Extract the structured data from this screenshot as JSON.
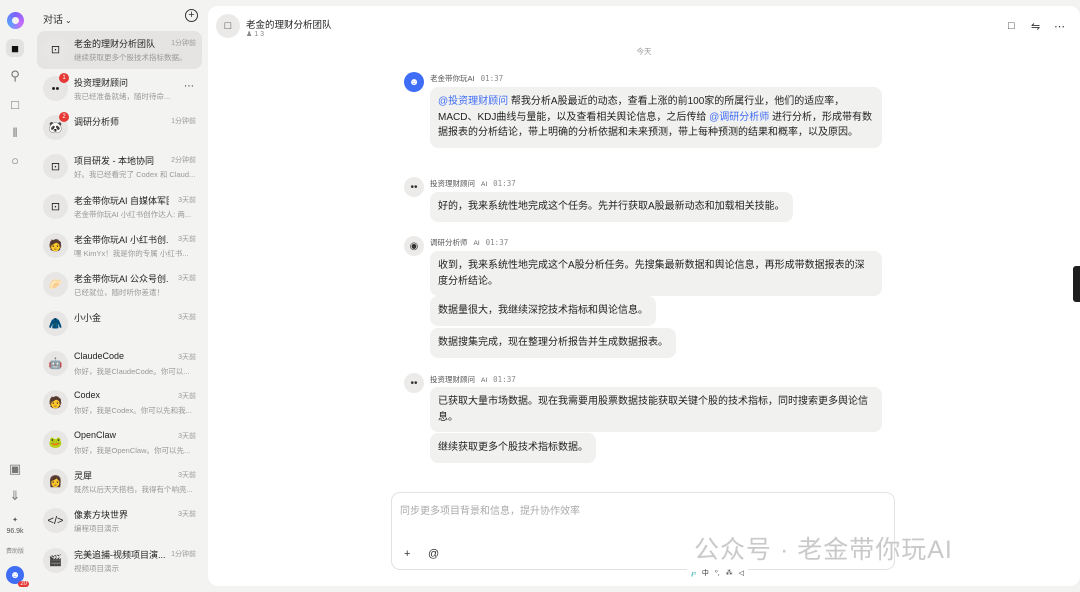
{
  "rail": {
    "points": "96.9k",
    "points_label": "费助版",
    "user_badge": "20"
  },
  "sidebar": {
    "header": "对话",
    "items": [
      {
        "title": "老金的理财分析团队",
        "time": "1分钟前",
        "preview": "继续获取更多个股技术指标数据。",
        "avatar": "⊡"
      },
      {
        "title": "投资理财顾问",
        "time": "",
        "preview": "我已经准备就绪，随时待命...",
        "avatar": "••",
        "badge": "1"
      },
      {
        "title": "调研分析师",
        "time": "1分钟前",
        "preview": "",
        "avatar": "🐼",
        "badge": "2"
      },
      {
        "title": "项目研发 - 本地协同",
        "time": "2分钟前",
        "preview": "好。我已经看完了 Codex 和 Claud...",
        "avatar": "⊡"
      },
      {
        "title": "老金带你玩AI 自媒体军团",
        "time": "3天前",
        "preview": "老金带你玩AI 小红书创作达人: 两...",
        "avatar": "⊡"
      },
      {
        "title": "老金带你玩AI 小红书创...",
        "time": "3天前",
        "preview": "嘿 KimYx！我是你的专属 小红书...",
        "avatar": "🧑"
      },
      {
        "title": "老金带你玩AI 公众号创...",
        "time": "3天前",
        "preview": "已经就位，随时听你差遣！",
        "avatar": "🥟"
      },
      {
        "title": "小小金",
        "time": "3天前",
        "preview": "",
        "avatar": "🧥"
      },
      {
        "title": "ClaudeCode",
        "time": "3天前",
        "preview": "你好，我是ClaudeCode。你可以...",
        "avatar": "🤖"
      },
      {
        "title": "Codex",
        "time": "3天前",
        "preview": "你好，我是Codex。你可以先和我...",
        "avatar": "🧑"
      },
      {
        "title": "OpenClaw",
        "time": "3天前",
        "preview": "你好，我是OpenClaw。你可以先...",
        "avatar": "🐸"
      },
      {
        "title": "灵犀",
        "time": "3天前",
        "preview": "既然以后天天搭档，我得有个响亮...",
        "avatar": "👩"
      },
      {
        "title": "像素方块世界",
        "time": "3天前",
        "preview": "编程项目演示",
        "avatar": "</>"
      },
      {
        "title": "完美追捕-视频项目演...",
        "time": "1分钟前",
        "preview": "视频项目演示",
        "avatar": "🎬"
      }
    ]
  },
  "chat": {
    "title": "老金的理财分析团队",
    "meta": "1   3",
    "date": "今天",
    "messages": [
      {
        "sender": "老金带你玩AI",
        "ai": "",
        "time": "01:37",
        "mention1": "@投资理财顾问",
        "text1": " 帮我分析A股最近的动态，查看上涨的前100家的所属行业，他们的适应率，MACD、KDJ曲线与量能，以及查看相关舆论信息，之后传给 ",
        "mention2": "@调研分析师",
        "text2": " 进行分析，形成带有数据报表的分析结论，带上明确的分析依据和未来预测，带上每种预测的结果和概率，以及原因。"
      },
      {
        "sender": "投资理财顾问",
        "ai": "AI",
        "time": "01:37",
        "bubbles": [
          "好的，我来系统性地完成这个任务。先并行获取A股最新动态和加载相关技能。"
        ]
      },
      {
        "sender": "调研分析师",
        "ai": "AI",
        "time": "01:37",
        "bubbles": [
          "收到，我来系统性地完成这个A股分析任务。先搜集最新数据和舆论信息，再形成带数据报表的深度分析结论。",
          "数据量很大，我继续深挖技术指标和舆论信息。",
          "数据搜集完成，现在整理分析报告并生成数据报表。"
        ]
      },
      {
        "sender": "投资理财顾问",
        "ai": "AI",
        "time": "01:37",
        "bubbles": [
          "已获取大量市场数据。现在我需要用股票数据技能获取关键个股的技术指标，同时搜索更多舆论信息。",
          "继续获取更多个股技术指标数据。"
        ]
      }
    ]
  },
  "composer": {
    "placeholder": "同步更多项目背景和信息，提升协作效率",
    "plus": "+",
    "at": "@"
  },
  "toolbar": {
    "items": [
      "中",
      "⁰,",
      "⁂",
      "◁"
    ]
  },
  "watermark": "公众号 · 老金带你玩AI"
}
